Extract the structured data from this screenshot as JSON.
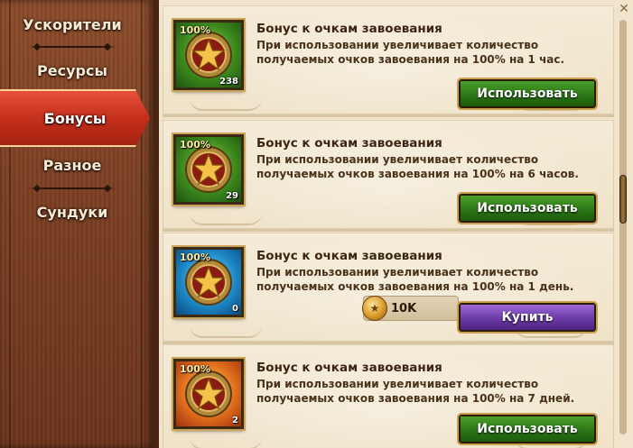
{
  "sidebar": {
    "items": [
      {
        "label": "Ускорители"
      },
      {
        "label": "Ресурсы"
      },
      {
        "label": "Бонусы"
      },
      {
        "label": "Разное"
      },
      {
        "label": "Сундуки"
      }
    ],
    "active_label": "Бонусы"
  },
  "items": [
    {
      "title": "Бонус к очкам завоевания",
      "desc": "При использовании увеличивает количество получаемых очков завоевания на 100% на 1 час.",
      "icon_badge": "100%",
      "count": "238",
      "icon_color": "green",
      "action_label": "Использовать"
    },
    {
      "title": "Бонус к очкам завоевания",
      "desc": "При использовании увеличивает количество получаемых очков завоевания на 100% на 6 часов.",
      "icon_badge": "100%",
      "count": "29",
      "icon_color": "green",
      "action_label": "Использовать"
    },
    {
      "title": "Бонус к очкам завоевания",
      "desc": "При использовании увеличивает количество получаемых очков завоевания на 100% на 1 день.",
      "icon_badge": "100%",
      "count": "0",
      "icon_color": "blue",
      "price": "10K",
      "action_label": "Купить"
    },
    {
      "title": "Бонус к очкам завоевания",
      "desc": "При использовании увеличивает количество получаемых очков завоевания на 100% на 7 дней.",
      "icon_badge": "100%",
      "count": "2",
      "icon_color": "orange",
      "action_label": "Использовать"
    }
  ],
  "colors": {
    "use_button": "#2e7a18",
    "buy_button": "#6d3eaa",
    "active_tab": "#c4301c"
  }
}
